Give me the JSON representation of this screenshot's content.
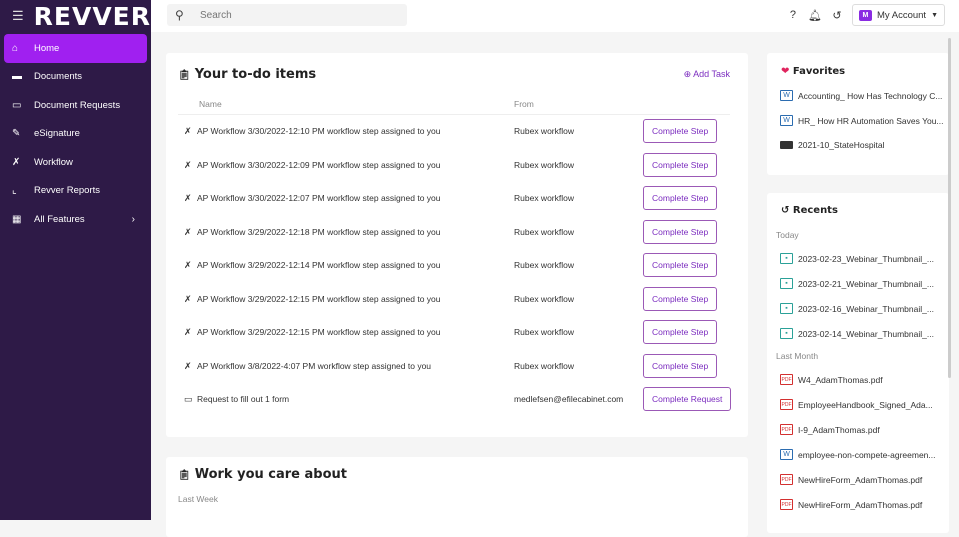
{
  "app": {
    "logo": "REVVER",
    "menu_icon": "hamburger-icon"
  },
  "sidebar": {
    "items": [
      {
        "label": "Home",
        "icon": "home-icon",
        "active": true
      },
      {
        "label": "Documents",
        "icon": "folder-icon"
      },
      {
        "label": "Document Requests",
        "icon": "inbox-icon"
      },
      {
        "label": "eSignature",
        "icon": "signature-icon"
      },
      {
        "label": "Workflow",
        "icon": "magic-wand-icon"
      },
      {
        "label": "Revver Reports",
        "icon": "chart-icon"
      },
      {
        "label": "All Features",
        "icon": "grid-icon",
        "chevron": "chevron-right-icon"
      }
    ]
  },
  "topbar": {
    "search_placeholder": "Search",
    "account_initial": "M",
    "account_label": "My Account",
    "accent": "#8a2be2"
  },
  "todo": {
    "title": "Your to-do items",
    "add_task": "Add Task",
    "col_name": "Name",
    "col_from": "From",
    "rows": [
      {
        "name": "AP Workflow 3/30/2022-12:10 PM workflow step assigned to you",
        "from": "Rubex workflow",
        "action": "Complete Step"
      },
      {
        "name": "AP Workflow 3/30/2022-12:09 PM workflow step assigned to you",
        "from": "Rubex workflow",
        "action": "Complete Step"
      },
      {
        "name": "AP Workflow 3/30/2022-12:07 PM workflow step assigned to you",
        "from": "Rubex workflow",
        "action": "Complete Step"
      },
      {
        "name": "AP Workflow 3/29/2022-12:18 PM workflow step assigned to you",
        "from": "Rubex workflow",
        "action": "Complete Step"
      },
      {
        "name": "AP Workflow 3/29/2022-12:14 PM workflow step assigned to you",
        "from": "Rubex workflow",
        "action": "Complete Step"
      },
      {
        "name": "AP Workflow 3/29/2022-12:15 PM workflow step assigned to you",
        "from": "Rubex workflow",
        "action": "Complete Step"
      },
      {
        "name": "AP Workflow 3/29/2022-12:15 PM workflow step assigned to you",
        "from": "Rubex workflow",
        "action": "Complete Step"
      },
      {
        "name": "AP Workflow 3/8/2022-4:07 PM workflow step assigned to you",
        "from": "Rubex workflow",
        "action": "Complete Step"
      },
      {
        "name": "Request to fill out 1 form",
        "from": "medlefsen@efilecabinet.com",
        "action": "Complete Request"
      }
    ]
  },
  "work": {
    "title": "Work you care about",
    "section": "Last Week"
  },
  "favorites": {
    "title": "Favorites",
    "items": [
      {
        "label": "Accounting_ How Has Technology C...",
        "type": "word"
      },
      {
        "label": "HR_ How HR Automation Saves You...",
        "type": "word"
      },
      {
        "label": "2021-10_StateHospital",
        "type": "folder"
      }
    ]
  },
  "recents": {
    "title": "Recents",
    "today_label": "Today",
    "last_month_label": "Last Month",
    "today": [
      {
        "label": "2023-02-23_Webinar_Thumbnail_...",
        "type": "img"
      },
      {
        "label": "2023-02-21_Webinar_Thumbnail_...",
        "type": "img"
      },
      {
        "label": "2023-02-16_Webinar_Thumbnail_...",
        "type": "img"
      },
      {
        "label": "2023-02-14_Webinar_Thumbnail_...",
        "type": "img"
      }
    ],
    "last_month": [
      {
        "label": "W4_AdamThomas.pdf",
        "type": "pdf"
      },
      {
        "label": "EmployeeHandbook_Signed_Ada...",
        "type": "pdf"
      },
      {
        "label": "I-9_AdamThomas.pdf",
        "type": "pdf"
      },
      {
        "label": "employee-non-compete-agreemen...",
        "type": "word"
      },
      {
        "label": "NewHireForm_AdamThomas.pdf",
        "type": "pdf"
      },
      {
        "label": "NewHireForm_AdamThomas.pdf",
        "type": "pdf"
      }
    ]
  }
}
